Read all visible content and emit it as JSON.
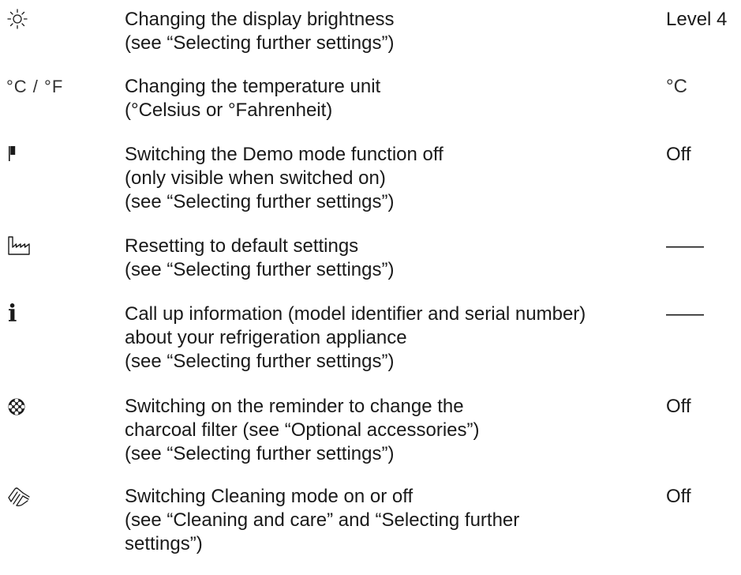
{
  "rows": [
    {
      "symbol": "brightness-icon",
      "description": [
        "Changing the display brightness",
        "(see “Selecting further settings”)"
      ],
      "value": "Level 4"
    },
    {
      "symbol_text": "°C / °F",
      "symbol": "temperature-unit-icon",
      "description": [
        "Changing the temperature unit",
        "(°Celsius or °Fahrenheit)"
      ],
      "value": "°C"
    },
    {
      "symbol": "demo-mode-icon",
      "description": [
        "Switching the Demo mode function off",
        "(only visible when switched on)",
        "(see “Selecting further settings”)"
      ],
      "value": "Off"
    },
    {
      "symbol": "factory-reset-icon",
      "description": [
        "Resetting to default settings",
        "(see “Selecting further settings”)"
      ],
      "value": "——"
    },
    {
      "symbol_text": "i",
      "symbol": "info-icon",
      "description": [
        "Call up information (model identifier and serial number)",
        "about your refrigeration appliance",
        "(see “Selecting further settings”)"
      ],
      "value": "——"
    },
    {
      "symbol": "charcoal-filter-icon",
      "description": [
        "Switching on the reminder to change the",
        "charcoal filter (see “Optional accessories”)",
        "(see “Selecting further settings”)"
      ],
      "value": "Off"
    },
    {
      "symbol": "cleaning-mode-icon",
      "description": [
        "Switching Cleaning mode on or off",
        "(see “Cleaning and care” and “Selecting further",
        "settings”)"
      ],
      "value": "Off"
    }
  ]
}
